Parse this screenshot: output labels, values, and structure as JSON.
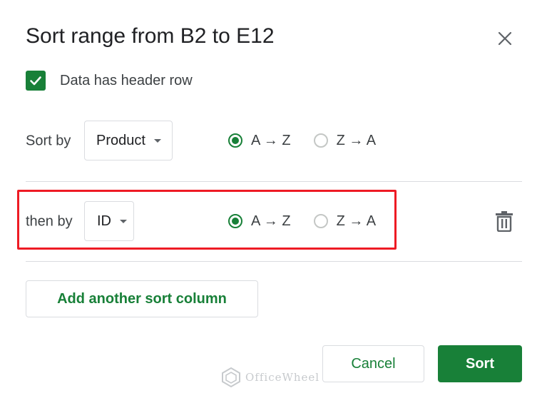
{
  "dialog": {
    "title": "Sort range from B2 to E12",
    "close_icon": "close-icon"
  },
  "header_row": {
    "checked": true,
    "label": "Data has header row"
  },
  "sort_by": {
    "label": "Sort by",
    "column": "Product",
    "options": [
      {
        "label": "A → Z",
        "selected": true
      },
      {
        "label": "Z → A",
        "selected": false
      }
    ]
  },
  "then_by": {
    "label": "then by",
    "column": "ID",
    "options": [
      {
        "label": "A → Z",
        "selected": true
      },
      {
        "label": "Z → A",
        "selected": false
      }
    ],
    "delete_icon": "trash-icon"
  },
  "add_sort_column_label": "Add another sort column",
  "buttons": {
    "cancel": "Cancel",
    "sort": "Sort"
  },
  "watermark": {
    "text": "OfficeWheel"
  },
  "colors": {
    "accent": "#188038",
    "highlight": "#ee1b24",
    "border": "#dadce0"
  }
}
